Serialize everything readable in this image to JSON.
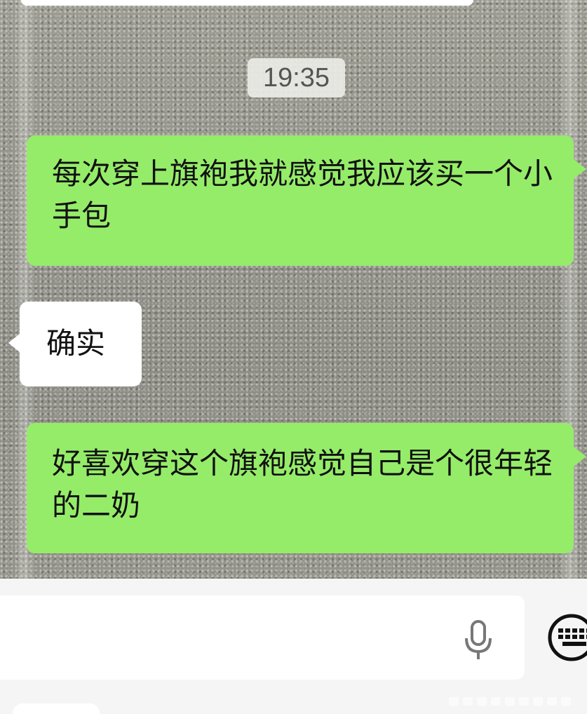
{
  "chat": {
    "timestamp": "19:35",
    "messages": [
      {
        "side": "sent",
        "text": "每次穿上旗袍我就感觉我应该买一个小手包"
      },
      {
        "side": "received",
        "text": "确实"
      },
      {
        "side": "sent",
        "text": "好喜欢穿这个旗袍感觉自己是个很年轻的二奶"
      }
    ]
  },
  "input_bar": {
    "message_value": "",
    "voice_icon": "microphone-icon",
    "keyboard_icon": "keyboard-icon"
  },
  "colors": {
    "sent_bubble": "#95ec69",
    "received_bubble": "#ffffff",
    "input_bar_bg": "#f5f5f5"
  }
}
